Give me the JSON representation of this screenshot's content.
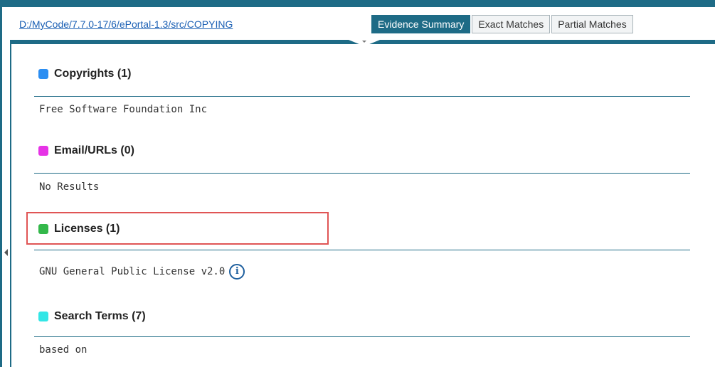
{
  "header": {
    "file_path": "D:/MyCode/7.7.0-17/6/ePortal-1.3/src/COPYING",
    "tabs": [
      {
        "label": "Evidence Summary",
        "active": true
      },
      {
        "label": "Exact Matches",
        "active": false
      },
      {
        "label": "Partial Matches",
        "active": false
      }
    ]
  },
  "sections": {
    "copyrights": {
      "title": "Copyrights (1)",
      "color": "#2b8ef2",
      "value": "Free Software Foundation Inc"
    },
    "emails": {
      "title": "Email/URLs (0)",
      "color": "#e633e6",
      "value": "No Results"
    },
    "licenses": {
      "title": "Licenses (1)",
      "color": "#33b84a",
      "value": "GNU General Public License v2.0",
      "info_icon": "i"
    },
    "search_terms": {
      "title": "Search Terms (7)",
      "color": "#33e6e6",
      "value": "based on"
    }
  },
  "colors": {
    "accent": "#1e6b86",
    "highlight": "#e05555"
  }
}
